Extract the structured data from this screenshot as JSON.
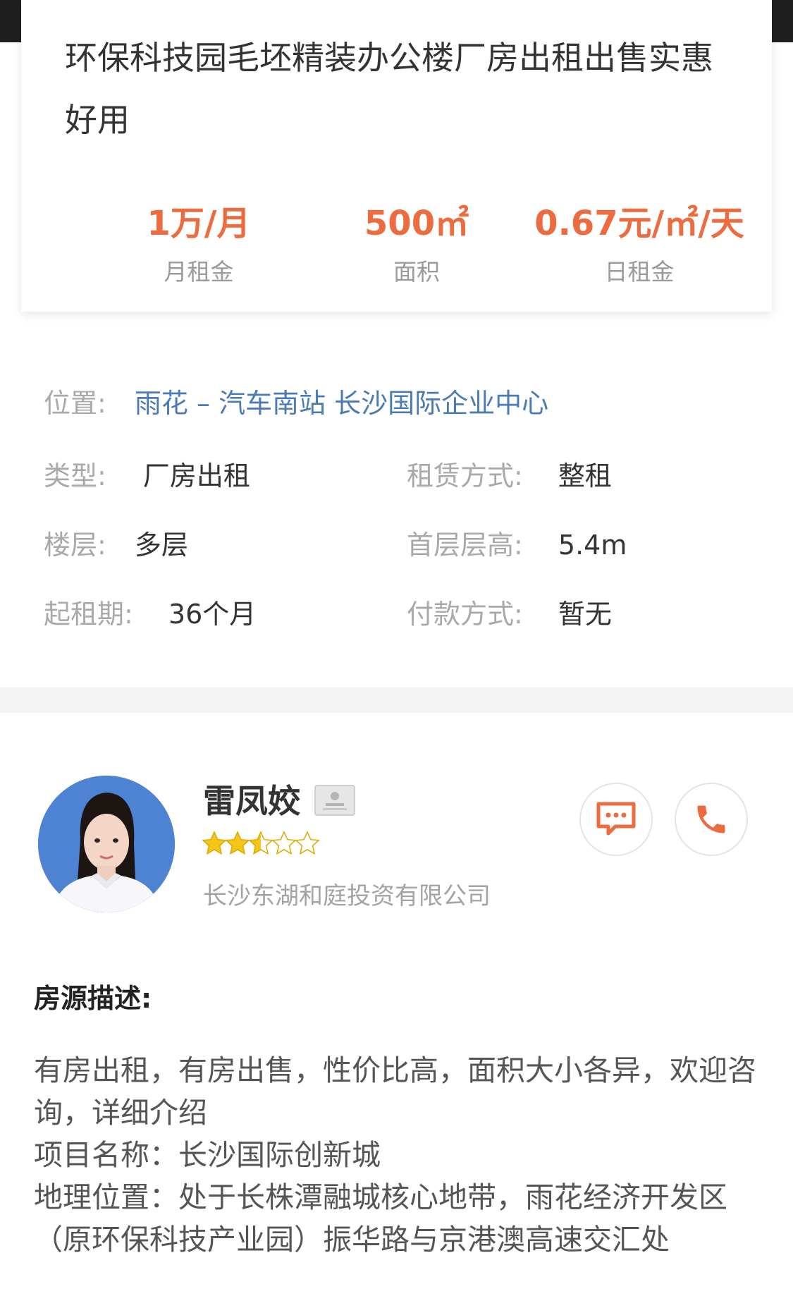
{
  "listing": {
    "title": "环保科技园毛坯精装办公楼厂房出租出售实惠好用",
    "stats": [
      {
        "value": "1万/月",
        "label": "月租金"
      },
      {
        "value": "500㎡",
        "label": "面积"
      },
      {
        "value": "0.67元/㎡/天",
        "label": "日租金"
      }
    ]
  },
  "details": {
    "location_label": "位置:",
    "location_value": "雨花 – 汽车南站  长沙国际企业中心",
    "type_label": "类型:",
    "type_value": "厂房出租",
    "lease_label": "租赁方式:",
    "lease_value": "整租",
    "floor_label": "楼层:",
    "floor_value": "多层",
    "height_label": "首层层高:",
    "height_value": "5.4m",
    "term_label": "起租期:",
    "term_value": "36个月",
    "payment_label": "付款方式:",
    "payment_value": "暂无"
  },
  "agent": {
    "name": "雷凤姣",
    "rating": 2.5,
    "company": "长沙东湖和庭投资有限公司"
  },
  "description": {
    "title": "房源描述:",
    "body": "有房出租，有房出售，性价比高，面积大小各异，欢迎咨询，详细介绍\n项目名称：长沙国际创新城\n地理位置：处于长株潭融城核心地带，雨花经济开发区（原环保科技产业园）振华路与京港澳高速交汇处"
  },
  "colors": {
    "accent": "#ec6b3f",
    "link": "#4b7bb5",
    "star": "#f5c518"
  },
  "icons": {
    "chat": "chat-bubble-icon",
    "phone": "phone-icon",
    "badge": "id-card-icon"
  }
}
